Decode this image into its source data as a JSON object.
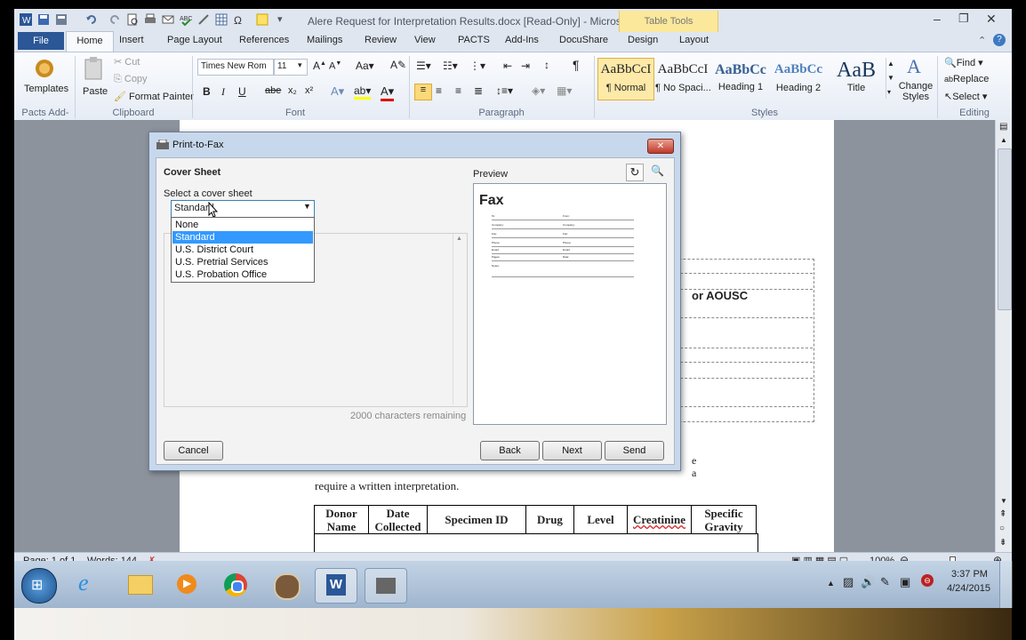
{
  "window": {
    "title": "Alere Request for Interpretation Results.docx [Read-Only]  -  Microsoft W...",
    "contextual_tab": "Table Tools",
    "tabs": [
      "File",
      "Home",
      "Insert",
      "Page Layout",
      "References",
      "Mailings",
      "Review",
      "View",
      "PACTS",
      "Add-Ins",
      "DocuShare",
      "Design",
      "Layout"
    ]
  },
  "ribbon": {
    "templates_label": "Templates",
    "pacts_group": "Pacts Add-in",
    "paste_label": "Paste",
    "cut_label": "Cut",
    "copy_label": "Copy",
    "format_painter_label": "Format Painter",
    "clipboard_group": "Clipboard",
    "font_name": "Times New Rom",
    "font_size": "11",
    "font_group": "Font",
    "paragraph_group": "Paragraph",
    "styles": [
      {
        "preview": "AaBbCcI",
        "name": "¶ Normal"
      },
      {
        "preview": "AaBbCcI",
        "name": "¶ No Spaci..."
      },
      {
        "preview": "AaBbCс",
        "name": "Heading 1"
      },
      {
        "preview": "AaBbCc",
        "name": "Heading 2"
      },
      {
        "preview": "AaB",
        "name": "Title"
      }
    ],
    "change_styles_label": "Change Styles",
    "styles_group": "Styles",
    "find_label": "Find",
    "replace_label": "Replace",
    "select_label": "Select",
    "editing_group": "Editing"
  },
  "dialog": {
    "title": "Print-to-Fax",
    "section_title": "Cover Sheet",
    "select_label": "Select a cover sheet",
    "selected_value": "Standard",
    "options": [
      "None",
      "Standard",
      "U.S. District Court",
      "U.S. Pretrial Services",
      "U.S. Probation Office"
    ],
    "highlighted_option": "Standard",
    "remaining_text": "2000 characters remaining",
    "preview_label": "Preview",
    "preview": {
      "heading": "Fax",
      "fields_left": [
        "To:",
        "Company:",
        "Fax:",
        "Phone:",
        "Email:",
        "Pages:",
        "Notes:"
      ],
      "fields_right": [
        "From:",
        "Company:",
        "Fax:",
        "Phone:",
        "Email:",
        "Date:"
      ]
    },
    "buttons": {
      "cancel": "Cancel",
      "back": "Back",
      "next": "Next",
      "send": "Send"
    }
  },
  "document": {
    "text_fragment": "or AOUSC",
    "paragraph_text": "require a written interpretation.",
    "table_headers": [
      "Donor Name",
      "Date Collected",
      "Specimen ID",
      "Drug",
      "Level",
      "Creatinine",
      "Specific Gravity"
    ]
  },
  "status_bar": {
    "page": "Page: 1 of 1",
    "words": "Words: 144",
    "zoom": "100%"
  },
  "taskbar": {
    "time": "3:37 PM",
    "date": "4/24/2015"
  }
}
